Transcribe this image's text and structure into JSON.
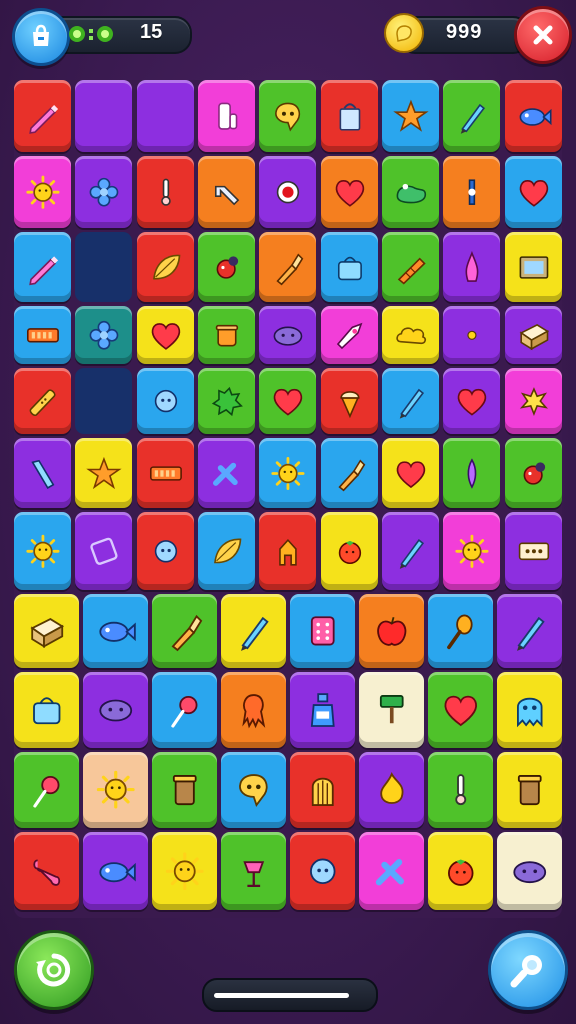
{
  "hud": {
    "moves_value": "15",
    "coins_value": "999"
  },
  "icons": {
    "shop": "shop-icon",
    "moves": "moves-icon",
    "coin": "coin-icon",
    "close": "close-icon",
    "shuffle": "shuffle-icon",
    "hint": "magnifier-icon"
  },
  "progress": {
    "fraction": 0.9
  },
  "board": {
    "rows": [
      [
        {
          "c": "#e8312a",
          "i": "pencil"
        },
        {
          "c": "#8d2fe0",
          "i": "none"
        },
        {
          "c": "#8d2fe0",
          "i": "none"
        },
        {
          "c": "#f23ed8",
          "i": "roll"
        },
        {
          "c": "#4fc22a",
          "i": "chat"
        },
        {
          "c": "#e8312a",
          "i": "bucket"
        },
        {
          "c": "#2aa6ee",
          "i": "star"
        },
        {
          "c": "#4fc22a",
          "i": "pen"
        },
        {
          "c": "#e8312a",
          "i": "fish"
        }
      ],
      [
        {
          "c": "#f23ed8",
          "i": "sun"
        },
        {
          "c": "#8d2fe0",
          "i": "flower"
        },
        {
          "c": "#e8312a",
          "i": "pin"
        },
        {
          "c": "#f57f1f",
          "i": "wrench"
        },
        {
          "c": "#8d2fe0",
          "i": "ring"
        },
        {
          "c": "#f57f1f",
          "i": "heart"
        },
        {
          "c": "#4fc22a",
          "i": "frog"
        },
        {
          "c": "#f57f1f",
          "i": "screw"
        },
        {
          "c": "#2aa6ee",
          "i": "heart"
        }
      ],
      [
        {
          "c": "#2aa6ee",
          "i": "pencil"
        },
        {
          "c": "empty",
          "i": "none"
        },
        {
          "c": "#e8312a",
          "i": "leaf"
        },
        {
          "c": "#4fc22a",
          "i": "bug"
        },
        {
          "c": "#f57f1f",
          "i": "brush"
        },
        {
          "c": "#2aa6ee",
          "i": "bag"
        },
        {
          "c": "#4fc22a",
          "i": "carrot"
        },
        {
          "c": "#8d2fe0",
          "i": "wing"
        },
        {
          "c": "#f5e21a",
          "i": "frame"
        }
      ],
      [
        {
          "c": "#2aa6ee",
          "i": "bar"
        },
        {
          "c": "#1d8f8a",
          "i": "flower"
        },
        {
          "c": "#f5e21a",
          "i": "heart"
        },
        {
          "c": "#4fc22a",
          "i": "cup"
        },
        {
          "c": "#8d2fe0",
          "i": "blob"
        },
        {
          "c": "#f23ed8",
          "i": "rocket"
        },
        {
          "c": "#f5e21a",
          "i": "cloud"
        },
        {
          "c": "#8d2fe0",
          "i": "dot"
        },
        {
          "c": "#8d2fe0",
          "i": "box"
        }
      ],
      [
        {
          "c": "#e8312a",
          "i": "bandage"
        },
        {
          "c": "empty",
          "i": "none"
        },
        {
          "c": "#2aa6ee",
          "i": "button"
        },
        {
          "c": "#4fc22a",
          "i": "splat"
        },
        {
          "c": "#4fc22a",
          "i": "heart"
        },
        {
          "c": "#e8312a",
          "i": "cone"
        },
        {
          "c": "#2aa6ee",
          "i": "pen"
        },
        {
          "c": "#8d2fe0",
          "i": "heart"
        },
        {
          "c": "#f23ed8",
          "i": "pop"
        }
      ],
      [
        {
          "c": "#8d2fe0",
          "i": "tube"
        },
        {
          "c": "#f5e21a",
          "i": "star"
        },
        {
          "c": "#e8312a",
          "i": "bar"
        },
        {
          "c": "#8d2fe0",
          "i": "cross"
        },
        {
          "c": "#2aa6ee",
          "i": "sun"
        },
        {
          "c": "#2aa6ee",
          "i": "brush"
        },
        {
          "c": "#f5e21a",
          "i": "heart"
        },
        {
          "c": "#4fc22a",
          "i": "feather"
        },
        {
          "c": "#4fc22a",
          "i": "bug"
        }
      ],
      [
        {
          "c": "#2aa6ee",
          "i": "sun"
        },
        {
          "c": "#8d2fe0",
          "i": "tag"
        },
        {
          "c": "#e8312a",
          "i": "button"
        },
        {
          "c": "#2aa6ee",
          "i": "leaf"
        },
        {
          "c": "#e8312a",
          "i": "gate"
        },
        {
          "c": "#f5e21a",
          "i": "tomato"
        },
        {
          "c": "#8d2fe0",
          "i": "pen"
        },
        {
          "c": "#f23ed8",
          "i": "sun"
        },
        {
          "c": "#8d2fe0",
          "i": "label"
        }
      ],
      [
        {
          "c": "#f5e21a",
          "i": "box"
        },
        {
          "c": "#2aa6ee",
          "i": "fish"
        },
        {
          "c": "#4fc22a",
          "i": "brush"
        },
        {
          "c": "#f5e21a",
          "i": "pen"
        },
        {
          "c": "#2aa6ee",
          "i": "dice"
        },
        {
          "c": "#f57f1f",
          "i": "apple"
        },
        {
          "c": "#2aa6ee",
          "i": "spoon"
        },
        {
          "c": "#8d2fe0",
          "i": "pen"
        }
      ],
      [
        {
          "c": "#f5e21a",
          "i": "bag"
        },
        {
          "c": "#8d2fe0",
          "i": "blob"
        },
        {
          "c": "#2aa6ee",
          "i": "lolly"
        },
        {
          "c": "#f57f1f",
          "i": "squid"
        },
        {
          "c": "#8d2fe0",
          "i": "bottle"
        },
        {
          "c": "#f7f0d0",
          "i": "roller"
        },
        {
          "c": "#4fc22a",
          "i": "heart"
        },
        {
          "c": "#f5e21a",
          "i": "ghost"
        }
      ],
      [
        {
          "c": "#4fc22a",
          "i": "lolly"
        },
        {
          "c": "#f7c79a",
          "i": "sun"
        },
        {
          "c": "#4fc22a",
          "i": "jar"
        },
        {
          "c": "#2aa6ee",
          "i": "chat"
        },
        {
          "c": "#e8312a",
          "i": "cage"
        },
        {
          "c": "#8d2fe0",
          "i": "flame"
        },
        {
          "c": "#4fc22a",
          "i": "pin"
        },
        {
          "c": "#f5e21a",
          "i": "jar"
        }
      ],
      [
        {
          "c": "#e8312a",
          "i": "bone"
        },
        {
          "c": "#8d2fe0",
          "i": "fish"
        },
        {
          "c": "#f5e21a",
          "i": "sun"
        },
        {
          "c": "#4fc22a",
          "i": "lamp"
        },
        {
          "c": "#e8312a",
          "i": "button"
        },
        {
          "c": "#f23ed8",
          "i": "cross"
        },
        {
          "c": "#f5e21a",
          "i": "tomato"
        },
        {
          "c": "#f7f0d0",
          "i": "blob"
        }
      ]
    ]
  }
}
